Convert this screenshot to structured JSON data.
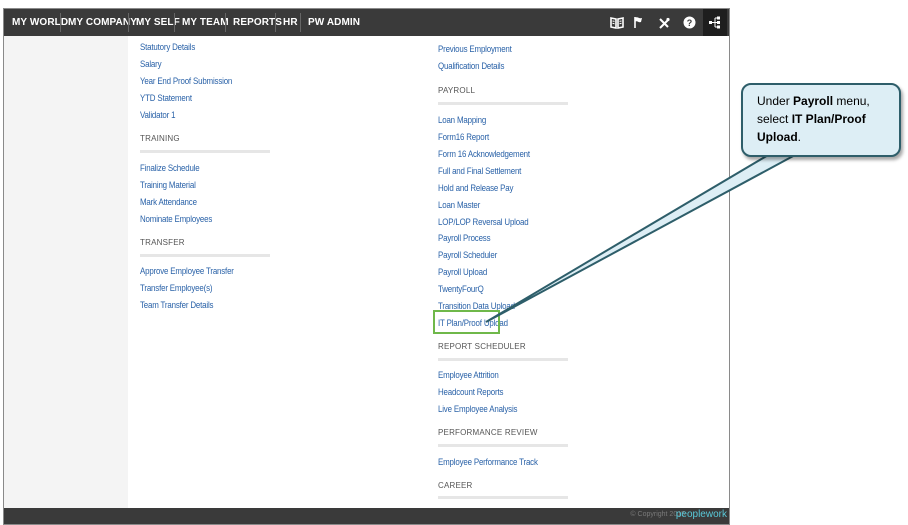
{
  "nav": {
    "items": [
      "MY WORLD",
      "MY COMPANY",
      "MY SELF",
      "MY TEAM",
      "REPORTS",
      "HR",
      "PW ADMIN"
    ],
    "icons": [
      "book-icon",
      "flag-icon",
      "tools-icon",
      "help-icon",
      "sitemap-icon"
    ]
  },
  "left_column": {
    "top_links": [
      "Statutory Details",
      "Salary",
      "Year End Proof Submission",
      "YTD Statement",
      "Validator 1"
    ],
    "training": {
      "title": "TRAINING",
      "links": [
        "Finalize Schedule",
        "Training Material",
        "Mark Attendance",
        "Nominate Employees"
      ]
    },
    "transfer": {
      "title": "TRANSFER",
      "links": [
        "Approve Employee Transfer",
        "Transfer Employee(s)",
        "Team Transfer Details"
      ]
    }
  },
  "right_column": {
    "top_links": [
      "Previous Employment",
      "Qualification Details"
    ],
    "payroll": {
      "title": "PAYROLL",
      "links": [
        "Loan Mapping",
        "Form16 Report",
        "Form 16 Acknowledgement",
        "Full and Final Settlement",
        "Hold and Release Pay",
        "Loan Master",
        "LOP/LOP Reversal Upload",
        "Payroll Process",
        "Payroll Scheduler",
        "Payroll Upload",
        "TwentyFourQ",
        "Transition Data Upload",
        "IT Plan/Proof Upload"
      ]
    },
    "report_scheduler": {
      "title": "REPORT SCHEDULER",
      "links": [
        "Employee Attrition",
        "Headcount Reports",
        "Live Employee Analysis"
      ]
    },
    "performance_review": {
      "title": "PERFORMANCE REVIEW",
      "links": [
        "Employee Performance Track"
      ]
    },
    "career": {
      "title": "CAREER"
    }
  },
  "footer": {
    "copyright": "© Copyright 2015",
    "logo": "peoplework"
  },
  "callout": {
    "t1": "Under ",
    "b1": "Payroll",
    "t2": " menu, select ",
    "b2": "IT Plan/Proof Upload",
    "t3": "."
  },
  "colors": {
    "navbar": "#3a3a3a",
    "link": "#2a62a8",
    "highlight": "#6fb84a",
    "callout_fill": "#ddeef5",
    "callout_border": "#2e5e6a"
  }
}
